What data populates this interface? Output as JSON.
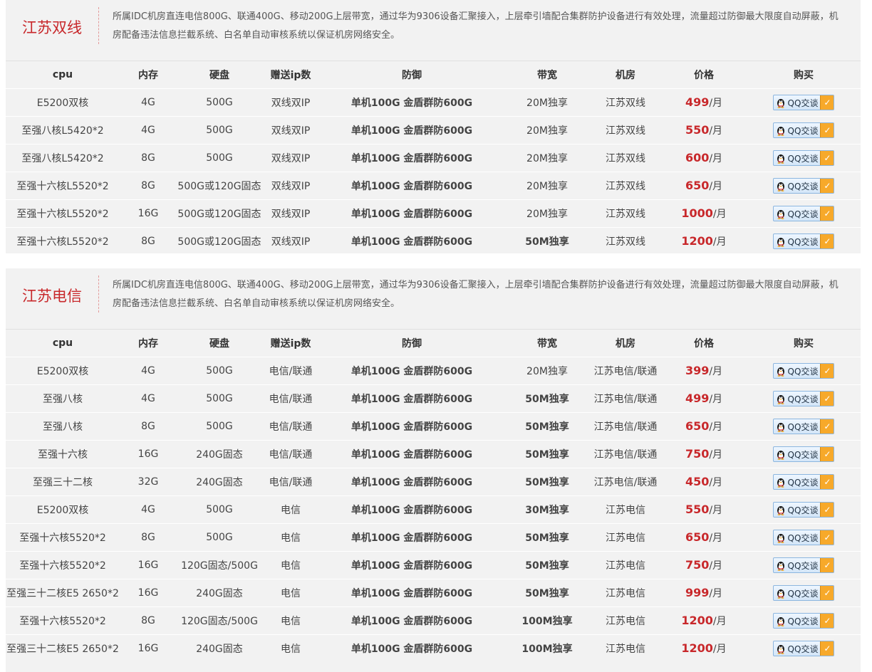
{
  "headers": [
    "cpu",
    "内存",
    "硬盘",
    "赠送ip数",
    "防御",
    "带宽",
    "机房",
    "价格",
    "购买"
  ],
  "buy_label": "QQ交谈",
  "sections": [
    {
      "title": "江苏双线",
      "desc": "所属IDC机房直连电信800G、联通400G、移动200G上层带宽，通过华为9306设备汇聚接入，上层牵引墙配合集群防护设备进行有效处理，流量超过防御最大限度自动屏蔽，机房配备违法信息拦截系统、白名单自动审核系统以保证机房网络安全。",
      "rows": [
        {
          "cpu": "E5200双核",
          "ram": "4G",
          "disk": "500G",
          "ip": "双线双IP",
          "defense": "单机100G 金盾群防600G",
          "bandwidth": "20M独享",
          "bw_hl": false,
          "room": "江苏双线",
          "price": "499",
          "unit": "/月"
        },
        {
          "cpu": "至强八核L5420*2",
          "ram": "4G",
          "disk": "500G",
          "ip": "双线双IP",
          "defense": "单机100G 金盾群防600G",
          "bandwidth": "20M独享",
          "bw_hl": false,
          "room": "江苏双线",
          "price": "550",
          "unit": "/月"
        },
        {
          "cpu": "至强八核L5420*2",
          "ram": "8G",
          "disk": "500G",
          "ip": "双线双IP",
          "defense": "单机100G 金盾群防600G",
          "bandwidth": "20M独享",
          "bw_hl": false,
          "room": "江苏双线",
          "price": "600",
          "unit": "/月"
        },
        {
          "cpu": "至强十六核L5520*2",
          "ram": "8G",
          "disk": "500G或120G固态",
          "ip": "双线双IP",
          "defense": "单机100G 金盾群防600G",
          "bandwidth": "20M独享",
          "bw_hl": false,
          "room": "江苏双线",
          "price": "650",
          "unit": "/月"
        },
        {
          "cpu": "至强十六核L5520*2",
          "ram": "16G",
          "disk": "500G或120G固态",
          "ip": "双线双IP",
          "defense": "单机100G 金盾群防600G",
          "bandwidth": "20M独享",
          "bw_hl": false,
          "room": "江苏双线",
          "price": "1000",
          "unit": "/月"
        },
        {
          "cpu": "至强十六核L5520*2",
          "ram": "8G",
          "disk": "500G或120G固态",
          "ip": "双线双IP",
          "defense": "单机100G 金盾群防600G",
          "bandwidth": "50M独享",
          "bw_hl": true,
          "room": "江苏双线",
          "price": "1200",
          "unit": "/月"
        }
      ]
    },
    {
      "title": "江苏电信",
      "desc": "所属IDC机房直连电信800G、联通400G、移动200G上层带宽，通过华为9306设备汇聚接入，上层牵引墙配合集群防护设备进行有效处理，流量超过防御最大限度自动屏蔽，机房配备违法信息拦截系统、白名单自动审核系统以保证机房网络安全。",
      "rows": [
        {
          "cpu": "E5200双核",
          "ram": "4G",
          "disk": "500G",
          "ip": "电信/联通",
          "defense": "单机100G 金盾群防600G",
          "bandwidth": "20M独享",
          "bw_hl": false,
          "room": "江苏电信/联通",
          "price": "399",
          "unit": "/月"
        },
        {
          "cpu": "至强八核",
          "ram": "4G",
          "disk": "500G",
          "ip": "电信/联通",
          "defense": "单机100G 金盾群防600G",
          "bandwidth": "50M独享",
          "bw_hl": true,
          "room": "江苏电信/联通",
          "price": "499",
          "unit": "/月"
        },
        {
          "cpu": "至强八核",
          "ram": "8G",
          "disk": "500G",
          "ip": "电信/联通",
          "defense": "单机100G 金盾群防600G",
          "bandwidth": "50M独享",
          "bw_hl": true,
          "room": "江苏电信/联通",
          "price": "650",
          "unit": "/月"
        },
        {
          "cpu": "至强十六核",
          "ram": "16G",
          "disk": "240G固态",
          "ip": "电信/联通",
          "defense": "单机100G 金盾群防600G",
          "bandwidth": "50M独享",
          "bw_hl": true,
          "room": "江苏电信/联通",
          "price": "750",
          "unit": "/月"
        },
        {
          "cpu": "至强三十二核",
          "ram": "32G",
          "disk": "240G固态",
          "ip": "电信/联通",
          "defense": "单机100G 金盾群防600G",
          "bandwidth": "50M独享",
          "bw_hl": true,
          "room": "江苏电信/联通",
          "price": "450",
          "unit": "/月"
        },
        {
          "cpu": "E5200双核",
          "ram": "4G",
          "disk": "500G",
          "ip": "电信",
          "defense": "单机100G 金盾群防600G",
          "bandwidth": "30M独享",
          "bw_hl": true,
          "room": "江苏电信",
          "price": "550",
          "unit": "/月"
        },
        {
          "cpu": "至强十六核5520*2",
          "ram": "8G",
          "disk": "500G",
          "ip": "电信",
          "defense": "单机100G 金盾群防600G",
          "bandwidth": "50M独享",
          "bw_hl": true,
          "room": "江苏电信",
          "price": "650",
          "unit": "/月"
        },
        {
          "cpu": "至强十六核5520*2",
          "ram": "16G",
          "disk": "120G固态/500G",
          "ip": "电信",
          "defense": "单机100G 金盾群防600G",
          "bandwidth": "50M独享",
          "bw_hl": true,
          "room": "江苏电信",
          "price": "750",
          "unit": "/月"
        },
        {
          "cpu": "至强三十二核E5 2650*2",
          "ram": "16G",
          "disk": "240G固态",
          "ip": "电信",
          "defense": "单机100G 金盾群防600G",
          "bandwidth": "50M独享",
          "bw_hl": true,
          "room": "江苏电信",
          "price": "999",
          "unit": "/月"
        },
        {
          "cpu": "至强十六核5520*2",
          "ram": "8G",
          "disk": "120G固态/500G",
          "ip": "电信",
          "defense": "单机100G 金盾群防600G",
          "bandwidth": "100M独享",
          "bw_hl": true,
          "room": "江苏电信",
          "price": "1200",
          "unit": "/月"
        },
        {
          "cpu": "至强三十二核E5 2650*2",
          "ram": "16G",
          "disk": "240G固态",
          "ip": "电信",
          "defense": "单机100G 金盾群防600G",
          "bandwidth": "100M独享",
          "bw_hl": true,
          "room": "江苏电信",
          "price": "1200",
          "unit": "/月"
        }
      ]
    }
  ]
}
